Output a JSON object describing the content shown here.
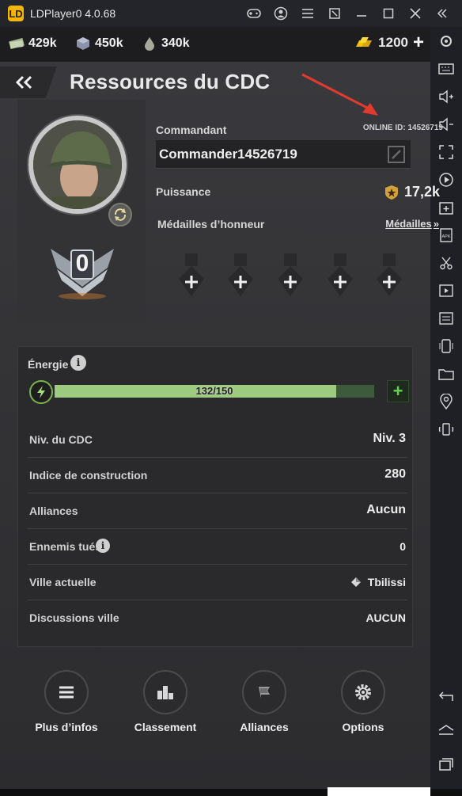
{
  "window": {
    "title": "LDPlayer0 4.0.68",
    "logo_text": "LD"
  },
  "resources": {
    "cash": "429k",
    "steel": "450k",
    "oil": "340k",
    "gold": "1200"
  },
  "header": {
    "title": "Ressources du CDC"
  },
  "profile": {
    "rank": "0",
    "commander_label": "Commandant",
    "online_id": "ONLINE ID: 14526719",
    "commander_name": "Commander14526719",
    "power_label": "Puissance",
    "power_value": "17,2k",
    "medals_label": "Médailles d’honneur",
    "medals_link": "Médailles"
  },
  "energy": {
    "label": "Énergie",
    "current": 132,
    "max": 150,
    "text": "132/150"
  },
  "stats": [
    {
      "label": "Niv. du CDC",
      "value": "Niv. 3"
    },
    {
      "label": "Indice de construction",
      "value": "280"
    },
    {
      "label": "Alliances",
      "value": "Aucun"
    },
    {
      "label": "Ennemis tués",
      "value": "0"
    },
    {
      "label": "Ville actuelle",
      "value": "Tbilissi"
    },
    {
      "label": "Discussions ville",
      "value": "AUCUN"
    }
  ],
  "bottom_nav": [
    {
      "label": "Plus d’infos",
      "icon": "menu-icon"
    },
    {
      "label": "Classement",
      "icon": "bar-chart-icon"
    },
    {
      "label": "Alliances",
      "icon": "flag-icon"
    },
    {
      "label": "Options",
      "icon": "gear-icon"
    }
  ],
  "colors": {
    "energy_fill": "#9cca7e",
    "plus_green": "#66d14f",
    "annotation_arrow": "#e23a2e",
    "gold": "#f2c200"
  }
}
